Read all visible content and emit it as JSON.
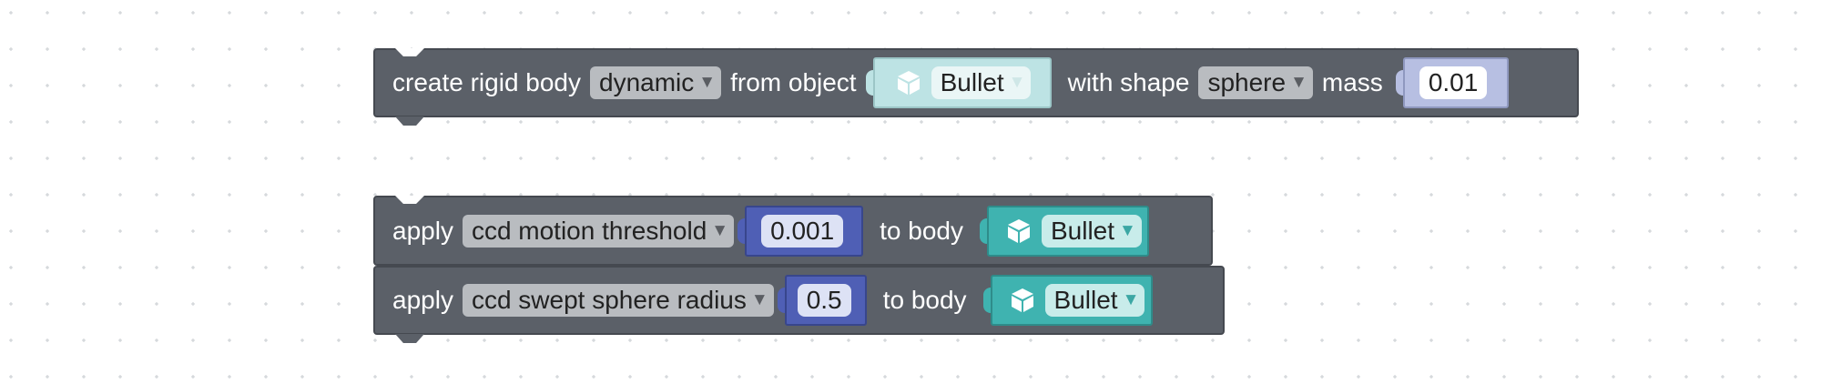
{
  "colors": {
    "workspace_bg": "#ffffff",
    "grid_dot": "#c9ccd1",
    "block_bg": "#5b6068",
    "dropdown_bg": "#b9bcc0",
    "object_light": "#bde3e4",
    "object_dark": "#3fb3b0",
    "number_light": "#b7bfe2",
    "number_dark": "#4f5fb5"
  },
  "create_block": {
    "label_create": "create rigid body",
    "type_dropdown": "dynamic",
    "label_from": "from object",
    "object_value": "Bullet",
    "label_shape": "with shape",
    "shape_dropdown": "sphere",
    "label_mass": "mass",
    "mass_value": "0.01"
  },
  "apply_block_1": {
    "label_apply": "apply",
    "property_dropdown": "ccd motion threshold",
    "value": "0.001",
    "label_to_body": "to body",
    "object_value": "Bullet"
  },
  "apply_block_2": {
    "label_apply": "apply",
    "property_dropdown": "ccd swept sphere radius",
    "value": "0.5",
    "label_to_body": "to body",
    "object_value": "Bullet"
  },
  "icons": {
    "dropdown_arrow": "▼",
    "object_icon": "cube-icon"
  }
}
